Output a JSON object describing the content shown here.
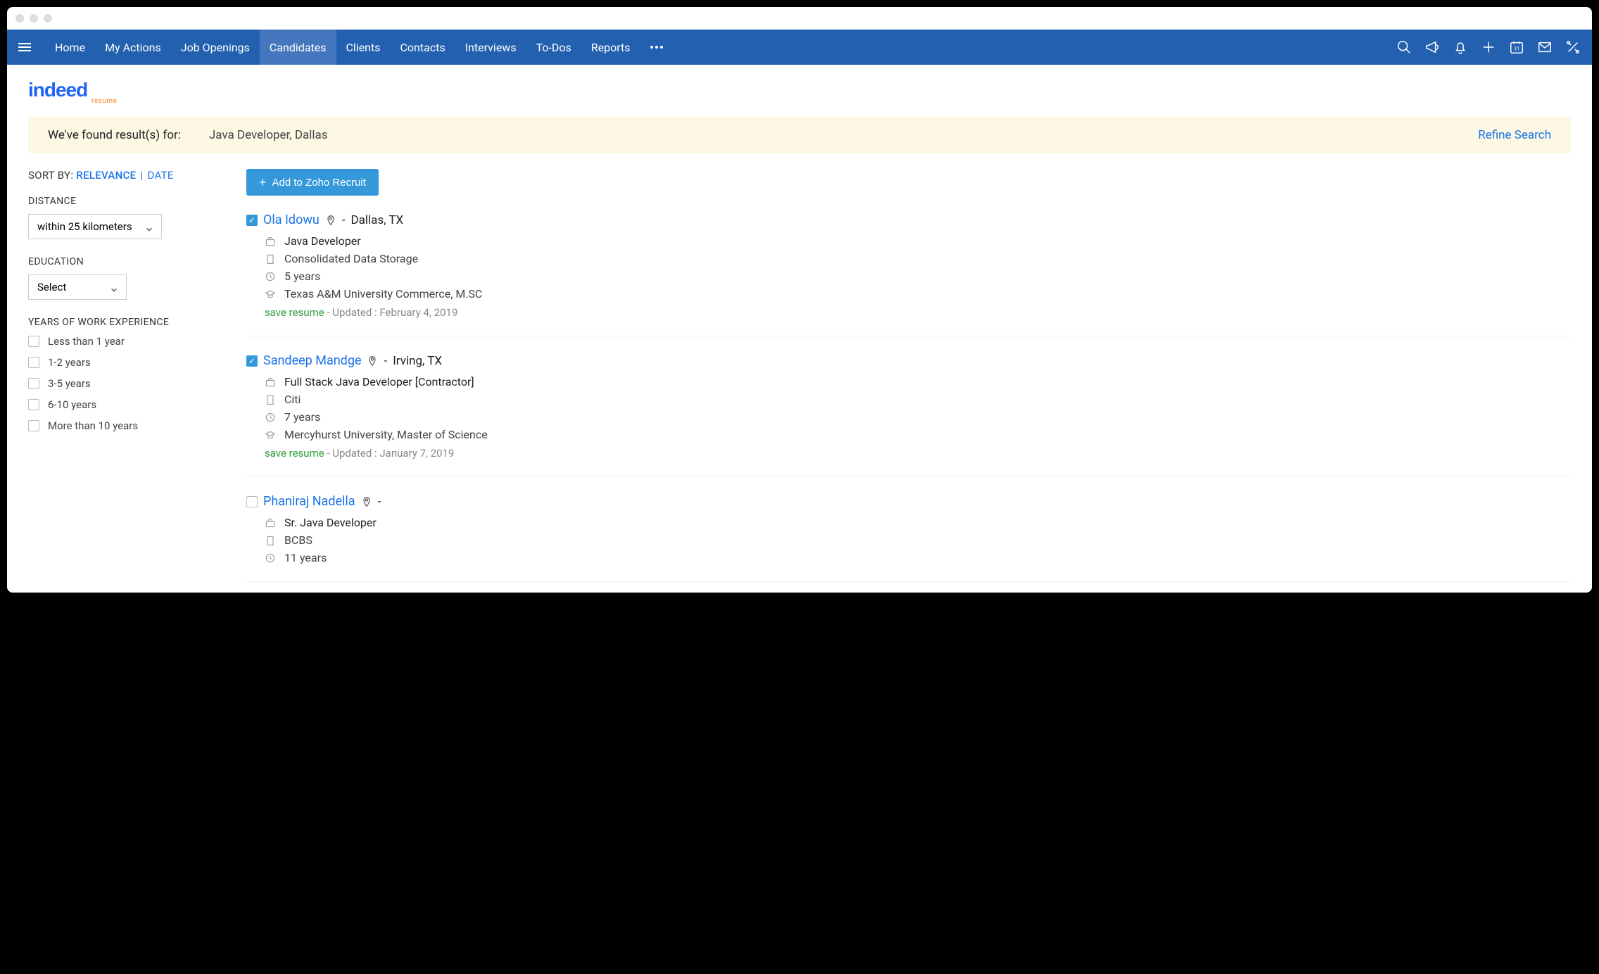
{
  "nav": {
    "items": [
      "Home",
      "My Actions",
      "Job Openings",
      "Candidates",
      "Clients",
      "Contacts",
      "Interviews",
      "To-Dos",
      "Reports"
    ],
    "activeIndex": 3
  },
  "logo": {
    "brand": "indeed",
    "sub": "resume"
  },
  "resultsBar": {
    "label": "We've found result(s) for:",
    "query": "Java Developer, Dallas",
    "refine": "Refine Search"
  },
  "sort": {
    "label": "SORT BY:",
    "relevance": "RELEVANCE",
    "sep": "|",
    "date": "DATE"
  },
  "filters": {
    "distance": {
      "title": "DISTANCE",
      "value": "within 25 kilometers"
    },
    "education": {
      "title": "EDUCATION",
      "value": "Select"
    },
    "experience": {
      "title": "YEARS OF WORK EXPERIENCE",
      "options": [
        "Less than 1 year",
        "1-2 years",
        "3-5 years",
        "6-10 years",
        "More than 10 years"
      ]
    }
  },
  "addButton": "Add to Zoho Recruit",
  "candidates": [
    {
      "checked": true,
      "name": "Ola Idowu",
      "locDash": "-",
      "location": "Dallas, TX",
      "title": "Java Developer",
      "company": "Consolidated Data Storage",
      "years": "5 years",
      "education": "Texas A&M University Commerce, M.SC",
      "save": "save resume",
      "updated": " - Updated : February 4, 2019"
    },
    {
      "checked": true,
      "name": "Sandeep Mandge",
      "locDash": "-",
      "location": "Irving, TX",
      "title": "Full Stack Java Developer [Contractor]",
      "company": "Citi",
      "years": "7 years",
      "education": "Mercyhurst University, Master of Science",
      "save": "save resume",
      "updated": " - Updated : January 7, 2019"
    },
    {
      "checked": false,
      "name": "Phaniraj Nadella",
      "locDash": "-",
      "location": "",
      "title": "Sr. Java Developer",
      "company": "BCBS",
      "years": "11 years",
      "education": "",
      "save": "",
      "updated": ""
    }
  ]
}
